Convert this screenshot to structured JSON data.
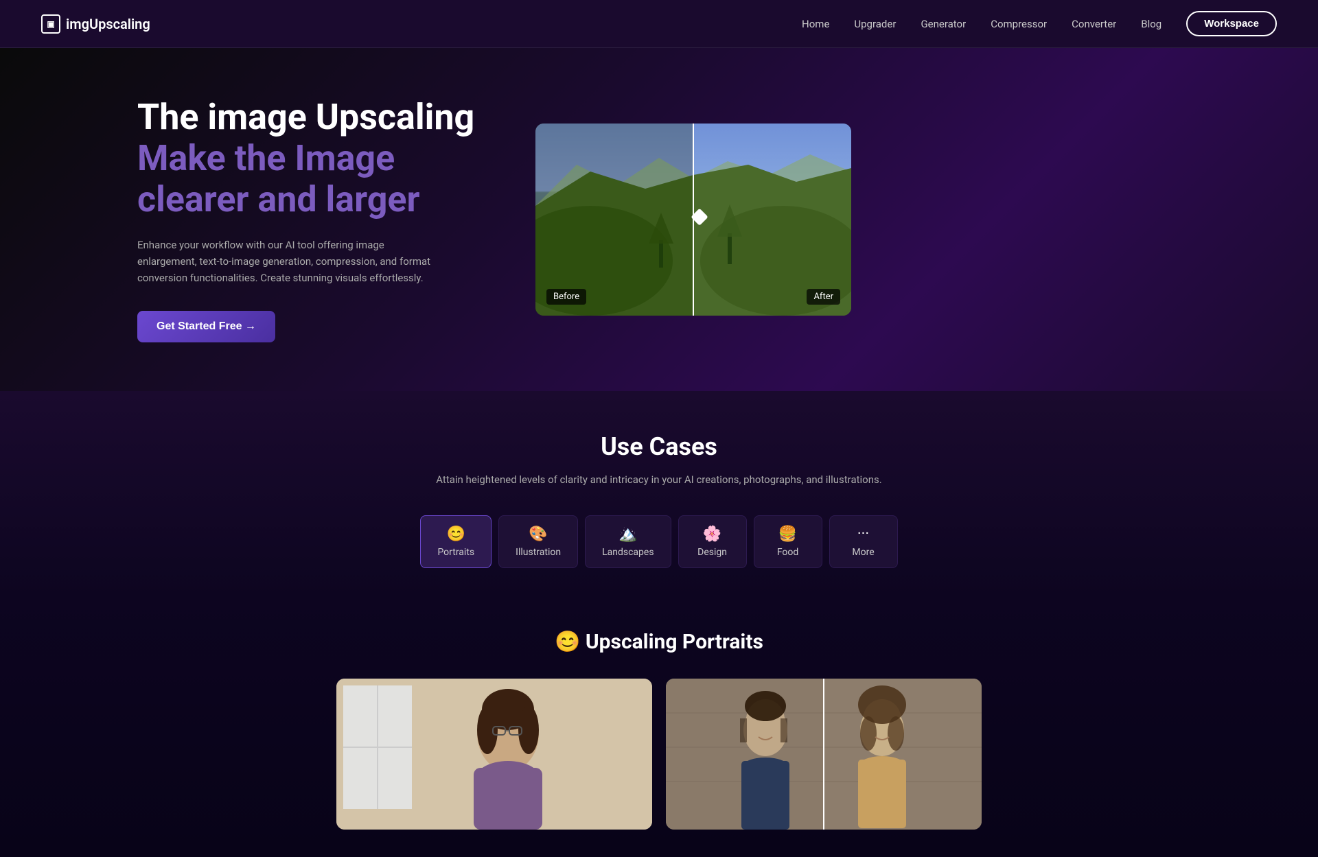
{
  "nav": {
    "logo_text": "imgUpscaling",
    "logo_icon": "▣",
    "links": [
      {
        "label": "Home",
        "key": "home"
      },
      {
        "label": "Upgrader",
        "key": "upgrader"
      },
      {
        "label": "Generator",
        "key": "generator"
      },
      {
        "label": "Compressor",
        "key": "compressor"
      },
      {
        "label": "Converter",
        "key": "converter"
      },
      {
        "label": "Blog",
        "key": "blog"
      }
    ],
    "workspace_label": "Workspace"
  },
  "hero": {
    "title_white": "The image Upscaling",
    "title_purple": "Make the Image clearer and larger",
    "subtitle": "Enhance your workflow with our AI tool offering image enlargement, text-to-image generation, compression, and format conversion functionalities. Create stunning visuals effortlessly.",
    "cta_label": "Get Started Free →",
    "before_label": "Before",
    "after_label": "After"
  },
  "use_cases": {
    "title": "Use Cases",
    "subtitle": "Attain heightened levels of clarity and intricacy in your AI creations, photographs, and illustrations.",
    "tabs": [
      {
        "emoji": "😊",
        "label": "Portraits",
        "key": "portraits"
      },
      {
        "emoji": "🎨",
        "label": "Illustration",
        "key": "illustration"
      },
      {
        "emoji": "🏔️",
        "label": "Landscapes",
        "key": "landscapes"
      },
      {
        "emoji": "🌸",
        "label": "Design",
        "key": "design"
      },
      {
        "emoji": "🍔",
        "label": "Food",
        "key": "food"
      },
      {
        "emoji": "...",
        "label": "More",
        "key": "more"
      }
    ]
  },
  "portraits_section": {
    "title_emoji": "😊",
    "title_text": "Upscaling Portraits"
  }
}
